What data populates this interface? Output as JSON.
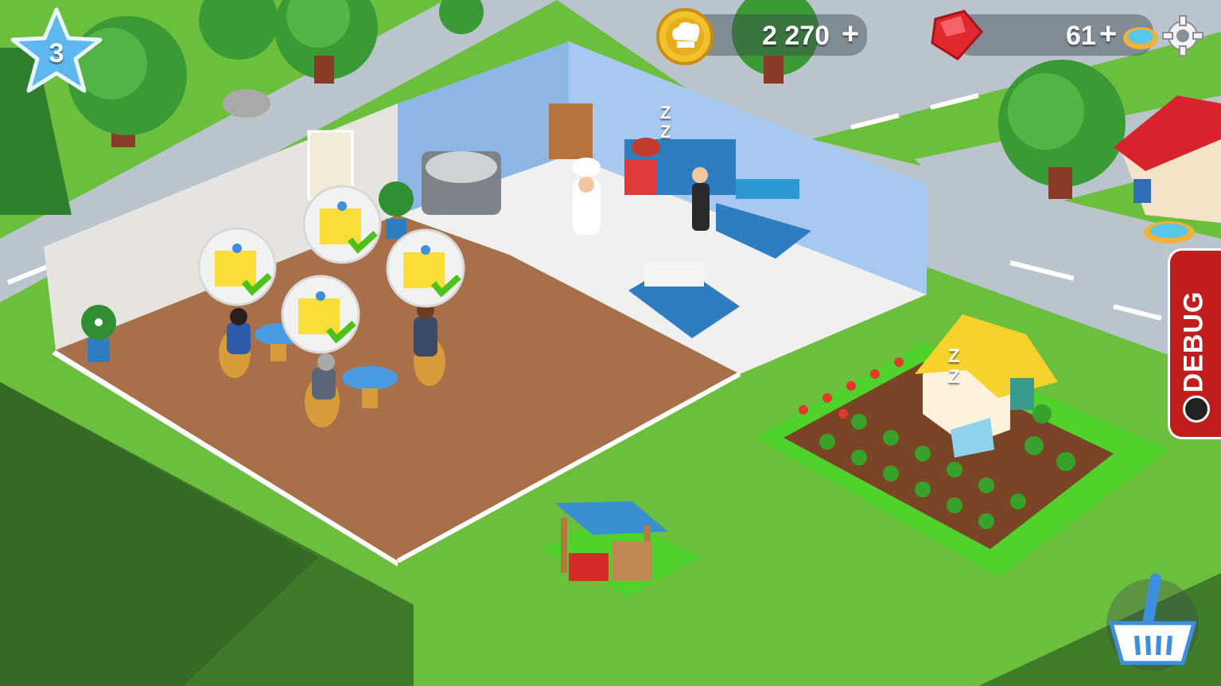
{
  "hud": {
    "level": "3",
    "coins": "2 270",
    "coins_plus": "+",
    "gems": "61",
    "gems_plus": "+"
  },
  "debug": {
    "label": "DEBUG"
  },
  "icons": {
    "level": "star-icon",
    "coins": "chef-hat-coin-icon",
    "gems": "ruby-gem-icon",
    "pool": "pool-icon",
    "settings": "gear-icon",
    "shop": "basket-icon",
    "debug_timer": "clock-icon",
    "order_done": "note-check-icon",
    "sleep": "zzz-icon"
  },
  "colors": {
    "grass": "#6cbf3c",
    "road": "#b9c4cc",
    "floor_wood": "#a8704a",
    "kitchen_wall": "#8eb6e4",
    "debug_red": "#c21d1d",
    "coin_gold": "#f2c12e",
    "gem_red": "#e0282e",
    "check_green": "#4cc21a"
  },
  "sleep_text": "Z Z"
}
